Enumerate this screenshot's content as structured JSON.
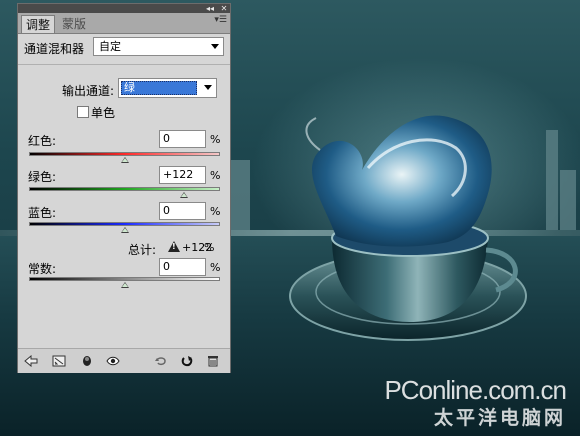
{
  "panel": {
    "tabs": [
      {
        "label": "调整",
        "active": true
      },
      {
        "label": "蒙版",
        "active": false
      }
    ],
    "topbar_icons": [
      "collapse-icon",
      "close-icon"
    ],
    "menu_icon": "panel-menu-icon",
    "title": "通道混和器",
    "preset": "自定",
    "output_channel_label": "输出通道:",
    "output_channel_value": "绿",
    "monochrome_label": "单色",
    "monochrome_checked": false,
    "sliders": [
      {
        "label": "红色:",
        "value": "0",
        "unit": "%",
        "position": 0.5,
        "gradient": [
          "#000000",
          "#ff2a2a",
          "#f4c8c8"
        ]
      },
      {
        "label": "绿色:",
        "value": "+122",
        "unit": "%",
        "position": 0.81,
        "gradient": [
          "#000000",
          "#1ea51e",
          "#c8f0c8"
        ]
      },
      {
        "label": "蓝色:",
        "value": "0",
        "unit": "%",
        "position": 0.5,
        "gradient": [
          "#000000",
          "#1a2aff",
          "#c8ccf8"
        ]
      }
    ],
    "total": {
      "label": "总计:",
      "value": "+122",
      "unit": "%"
    },
    "constant": {
      "label": "常数:",
      "value": "0",
      "unit": "%",
      "position": 0.5,
      "gradient": [
        "#000000",
        "#888888",
        "#ffffff"
      ]
    },
    "bottom_icons": [
      "back-arrow-icon",
      "fit-screen-icon",
      "clip-layer-icon",
      "visibility-eye-icon",
      "previous-state-icon",
      "reset-icon",
      "trash-icon"
    ]
  },
  "watermark": {
    "brand": "PConline.com.cn",
    "brand_cn": "太平洋电脑网"
  },
  "colors": {
    "panel_bg": "#d6d6d6",
    "selection_blue": "#3a78d8",
    "sea_dark": "#0a2127"
  }
}
